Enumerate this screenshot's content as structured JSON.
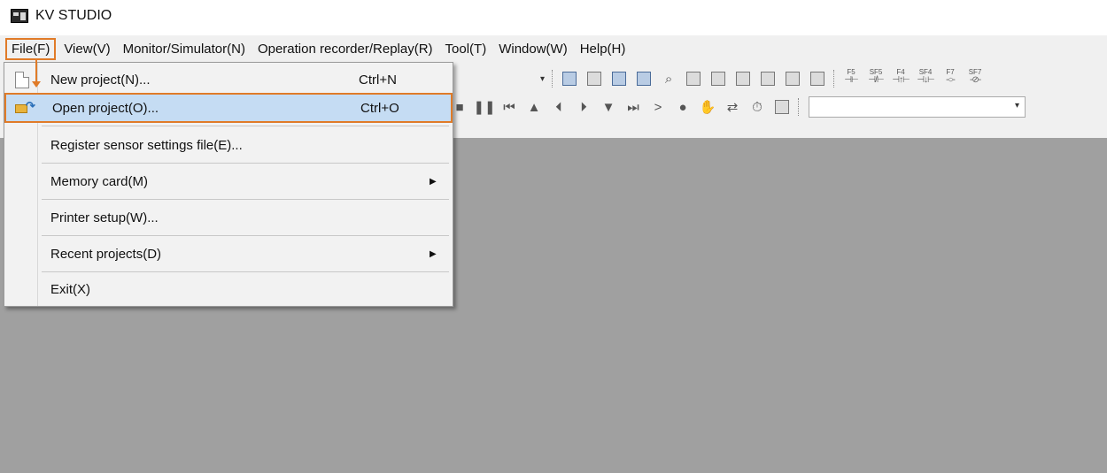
{
  "window": {
    "title": "KV STUDIO"
  },
  "menubar": {
    "items": [
      "File(F)",
      "View(V)",
      "Monitor/Simulator(N)",
      "Operation recorder/Replay(R)",
      "Tool(T)",
      "Window(W)",
      "Help(H)"
    ]
  },
  "file_menu": {
    "items": [
      {
        "label": "New project(N)...",
        "shortcut": "Ctrl+N",
        "icon": "new-document-icon"
      },
      {
        "label": "Open project(O)...",
        "shortcut": "Ctrl+O",
        "icon": "open-folder-icon",
        "highlighted": true
      },
      {
        "label": "Register sensor settings file(E)..."
      },
      {
        "label": "Memory card(M)",
        "submenu_arrow": "▶"
      },
      {
        "label": "Printer setup(W)..."
      },
      {
        "label": "Recent projects(D)",
        "submenu_arrow": "▶"
      },
      {
        "label": "Exit(X)"
      }
    ]
  },
  "toolbar": {
    "fn_keys": [
      {
        "top": "F5",
        "sym": "⊣⊢"
      },
      {
        "top": "SF5",
        "sym": "⊣/⊢"
      },
      {
        "top": "F4",
        "sym": "⊣↑⊢"
      },
      {
        "top": "SF4",
        "sym": "⊣↓⊢"
      },
      {
        "top": "F7",
        "sym": "-○-"
      },
      {
        "top": "SF7",
        "sym": "-⊘-"
      }
    ],
    "row1_icons": [
      "export-icon",
      "device-comment-icon",
      "transfer-icon",
      "write-icon",
      "search-icon",
      "check-icon",
      "cross-reference-icon",
      "grid-icon",
      "monitor-icon",
      "dev-icon",
      "dev-list-icon"
    ],
    "row2_icons": [
      "stop-icon",
      "pause-icon",
      "skip-back-icon",
      "step-up-icon",
      "step-back-icon",
      "step-forward-icon",
      "step-down-icon",
      "skip-forward-icon",
      "run-icon",
      "breakpoint-icon",
      "hand-icon",
      "trace-icon",
      "timer-icon",
      "counter-icon"
    ],
    "icon_glyphs": {
      "stop": "■",
      "pause": "❚❚",
      "skip_back": "⏮",
      "up": "▲",
      "step_back": "⏴",
      "step_fwd": "⏵",
      "down": "▼",
      "skip_fwd": "⏭",
      "run": ">",
      "break": "●",
      "hand": "✋",
      "trace": "⇄",
      "timer": "⏱",
      "search": "⌕",
      "dropdown": "▾"
    }
  },
  "colors": {
    "highlight_border": "#e07b28",
    "menu_highlight": "#c5dcf3",
    "workspace": "#a0a0a0"
  }
}
